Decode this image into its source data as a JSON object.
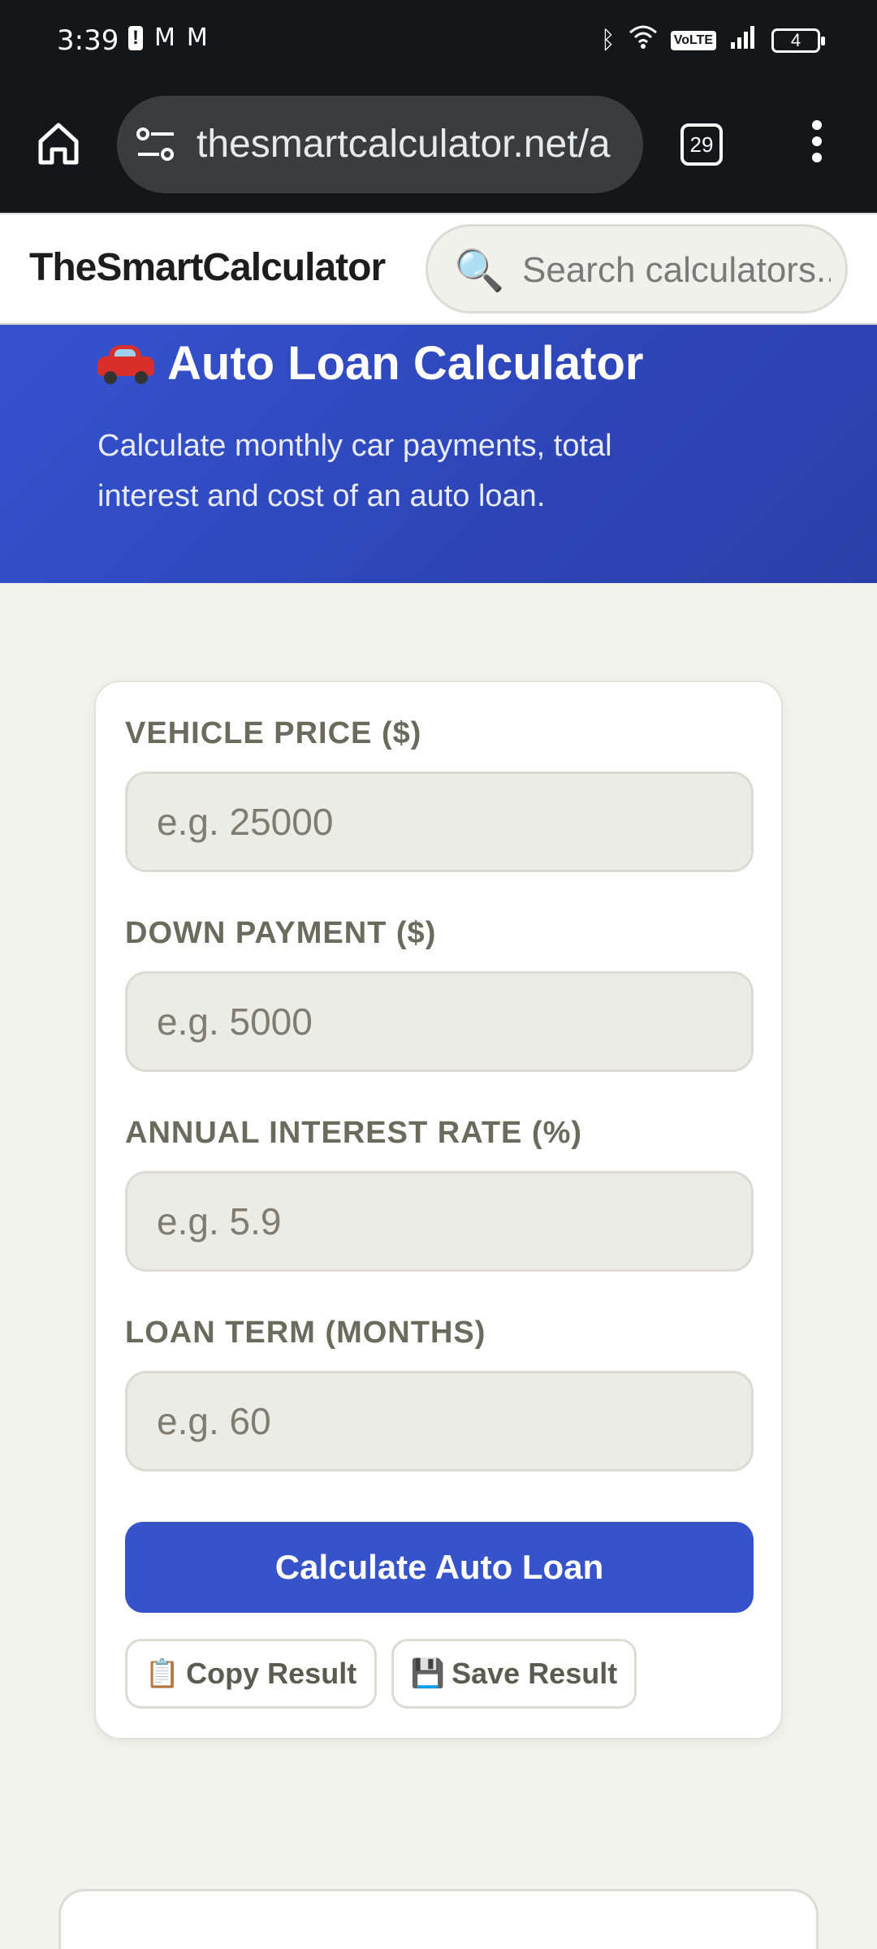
{
  "status": {
    "time": "3:39",
    "battery": "4",
    "network": "VoLTE"
  },
  "browser": {
    "url": "thesmartcalculator.net/a",
    "tab_count": "29"
  },
  "site": {
    "logo": "TheSmartCalculator",
    "search_placeholder": "Search calculators..."
  },
  "hero": {
    "title": "Auto Loan Calculator",
    "description": "Calculate monthly car payments, total interest and cost of an auto loan."
  },
  "form": {
    "fields": [
      {
        "label": "VEHICLE PRICE ($)",
        "placeholder": "e.g. 25000"
      },
      {
        "label": "DOWN PAYMENT ($)",
        "placeholder": "e.g. 5000"
      },
      {
        "label": "ANNUAL INTEREST RATE (%)",
        "placeholder": "e.g. 5.9"
      },
      {
        "label": "LOAN TERM (MONTHS)",
        "placeholder": "e.g. 60"
      }
    ],
    "calculate_label": "Calculate Auto Loan",
    "copy_label": "Copy Result",
    "save_label": "Save Result"
  },
  "icons": {
    "copy": "📋",
    "save": "💾",
    "search": "🔍",
    "car": "car-icon"
  },
  "colors": {
    "primary": "#3653c9",
    "hero_bg": "#2e45b8",
    "page_bg": "#f3f3ee"
  }
}
